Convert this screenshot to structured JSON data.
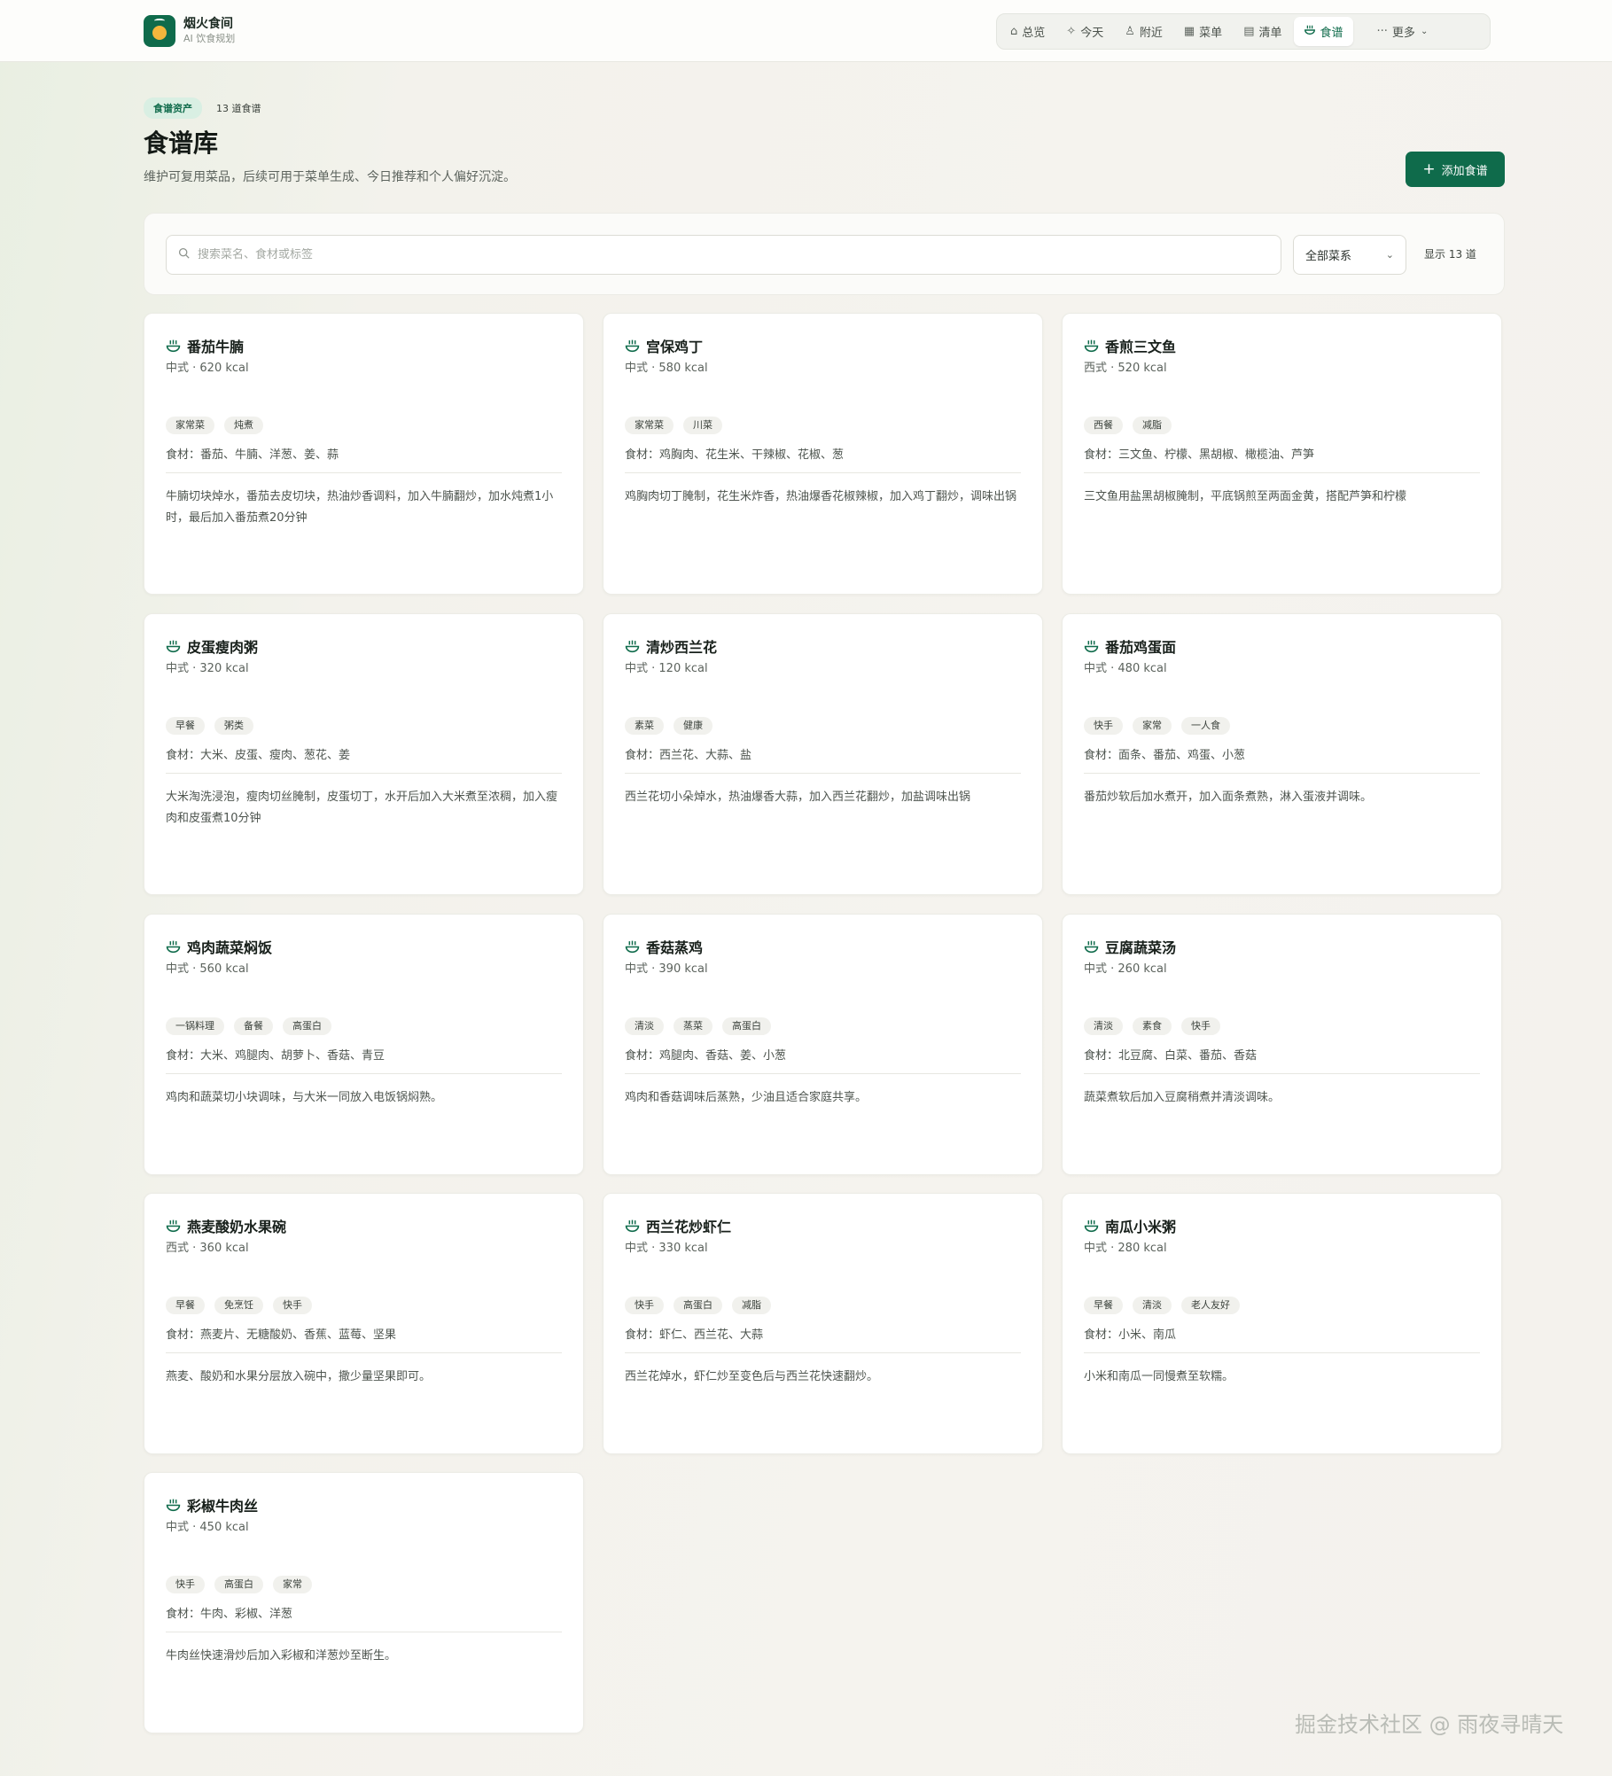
{
  "brand": {
    "name": "烟火食间",
    "subtitle": "AI 饮食规划"
  },
  "nav": {
    "items": [
      {
        "label": "总览",
        "icon": "home-icon",
        "active": false
      },
      {
        "label": "今天",
        "icon": "sparkle-icon",
        "active": false
      },
      {
        "label": "附近",
        "icon": "user-location-icon",
        "active": false
      },
      {
        "label": "菜单",
        "icon": "calendar-icon",
        "active": false
      },
      {
        "label": "清单",
        "icon": "clipboard-icon",
        "active": false
      },
      {
        "label": "食谱",
        "icon": "bowl-icon",
        "active": true
      }
    ],
    "more_label": "更多"
  },
  "header": {
    "badge": "食谱资产",
    "count": "13 道食谱",
    "title": "食谱库",
    "description": "维护可复用菜品，后续可用于菜单生成、今日推荐和个人偏好沉淀。",
    "add_button": "添加食谱"
  },
  "filter": {
    "search_placeholder": "搜索菜名、食材或标签",
    "cuisine_select": "全部菜系",
    "show_count": "显示 13 道"
  },
  "accent_color": "#0f6b4b",
  "recipes": [
    {
      "name": "番茄牛腩",
      "meta": "中式 · 620 kcal",
      "tags": [
        "家常菜",
        "炖煮"
      ],
      "ingredients": "食材：番茄、牛腩、洋葱、姜、蒜",
      "steps": "牛腩切块焯水，番茄去皮切块，热油炒香调料，加入牛腩翻炒，加水炖煮1小时，最后加入番茄煮20分钟"
    },
    {
      "name": "宫保鸡丁",
      "meta": "中式 · 580 kcal",
      "tags": [
        "家常菜",
        "川菜"
      ],
      "ingredients": "食材：鸡胸肉、花生米、干辣椒、花椒、葱",
      "steps": "鸡胸肉切丁腌制，花生米炸香，热油爆香花椒辣椒，加入鸡丁翻炒，调味出锅"
    },
    {
      "name": "香煎三文鱼",
      "meta": "西式 · 520 kcal",
      "tags": [
        "西餐",
        "减脂"
      ],
      "ingredients": "食材：三文鱼、柠檬、黑胡椒、橄榄油、芦笋",
      "steps": "三文鱼用盐黑胡椒腌制，平底锅煎至两面金黄，搭配芦笋和柠檬"
    },
    {
      "name": "皮蛋瘦肉粥",
      "meta": "中式 · 320 kcal",
      "tags": [
        "早餐",
        "粥类"
      ],
      "ingredients": "食材：大米、皮蛋、瘦肉、葱花、姜",
      "steps": "大米淘洗浸泡，瘦肉切丝腌制，皮蛋切丁，水开后加入大米煮至浓稠，加入瘦肉和皮蛋煮10分钟"
    },
    {
      "name": "清炒西兰花",
      "meta": "中式 · 120 kcal",
      "tags": [
        "素菜",
        "健康"
      ],
      "ingredients": "食材：西兰花、大蒜、盐",
      "steps": "西兰花切小朵焯水，热油爆香大蒜，加入西兰花翻炒，加盐调味出锅"
    },
    {
      "name": "番茄鸡蛋面",
      "meta": "中式 · 480 kcal",
      "tags": [
        "快手",
        "家常",
        "一人食"
      ],
      "ingredients": "食材：面条、番茄、鸡蛋、小葱",
      "steps": "番茄炒软后加水煮开，加入面条煮熟，淋入蛋液并调味。"
    },
    {
      "name": "鸡肉蔬菜焖饭",
      "meta": "中式 · 560 kcal",
      "tags": [
        "一锅料理",
        "备餐",
        "高蛋白"
      ],
      "ingredients": "食材：大米、鸡腿肉、胡萝卜、香菇、青豆",
      "steps": "鸡肉和蔬菜切小块调味，与大米一同放入电饭锅焖熟。"
    },
    {
      "name": "香菇蒸鸡",
      "meta": "中式 · 390 kcal",
      "tags": [
        "清淡",
        "蒸菜",
        "高蛋白"
      ],
      "ingredients": "食材：鸡腿肉、香菇、姜、小葱",
      "steps": "鸡肉和香菇调味后蒸熟，少油且适合家庭共享。"
    },
    {
      "name": "豆腐蔬菜汤",
      "meta": "中式 · 260 kcal",
      "tags": [
        "清淡",
        "素食",
        "快手"
      ],
      "ingredients": "食材：北豆腐、白菜、番茄、香菇",
      "steps": "蔬菜煮软后加入豆腐稍煮并清淡调味。"
    },
    {
      "name": "燕麦酸奶水果碗",
      "meta": "西式 · 360 kcal",
      "tags": [
        "早餐",
        "免烹饪",
        "快手"
      ],
      "ingredients": "食材：燕麦片、无糖酸奶、香蕉、蓝莓、坚果",
      "steps": "燕麦、酸奶和水果分层放入碗中，撒少量坚果即可。"
    },
    {
      "name": "西兰花炒虾仁",
      "meta": "中式 · 330 kcal",
      "tags": [
        "快手",
        "高蛋白",
        "减脂"
      ],
      "ingredients": "食材：虾仁、西兰花、大蒜",
      "steps": "西兰花焯水，虾仁炒至变色后与西兰花快速翻炒。"
    },
    {
      "name": "南瓜小米粥",
      "meta": "中式 · 280 kcal",
      "tags": [
        "早餐",
        "清淡",
        "老人友好"
      ],
      "ingredients": "食材：小米、南瓜",
      "steps": "小米和南瓜一同慢煮至软糯。"
    },
    {
      "name": "彩椒牛肉丝",
      "meta": "中式 · 450 kcal",
      "tags": [
        "快手",
        "高蛋白",
        "家常"
      ],
      "ingredients": "食材：牛肉、彩椒、洋葱",
      "steps": "牛肉丝快速滑炒后加入彩椒和洋葱炒至断生。"
    }
  ],
  "watermark": "掘金技术社区 @ 雨夜寻晴天"
}
